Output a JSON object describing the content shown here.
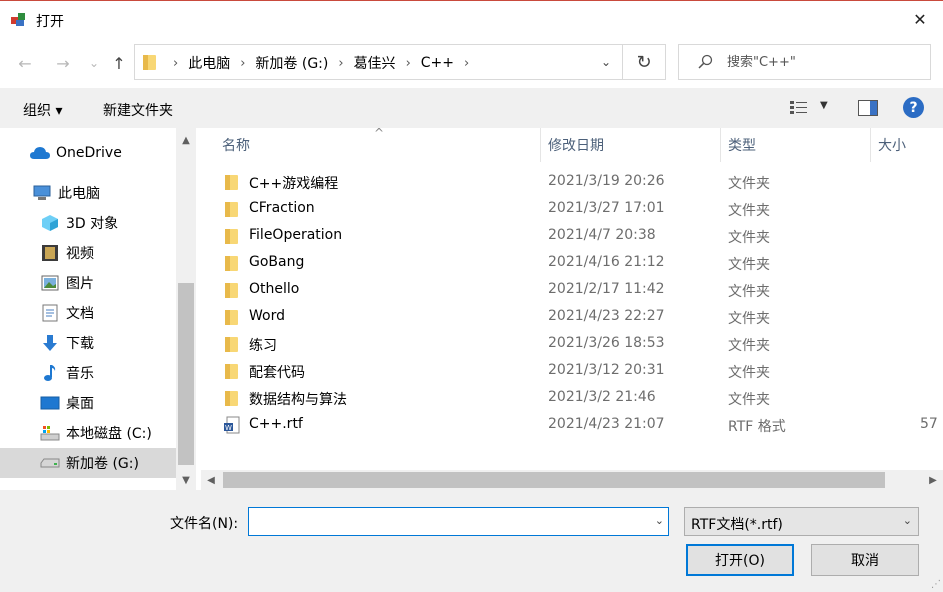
{
  "window": {
    "title": "打开",
    "close_glyph": "✕"
  },
  "nav": {
    "back_glyph": "←",
    "forward_glyph": "→",
    "recent_glyph": "⌄",
    "up_glyph": "↑",
    "breadcrumbs": [
      "此电脑",
      "新加卷 (G:)",
      "葛佳兴",
      "C++"
    ],
    "sep_glyph": "›",
    "dropdown_glyph": "⌄",
    "refresh_glyph": "↻"
  },
  "search": {
    "placeholder": "搜索\"C++\""
  },
  "toolbar": {
    "organize": "组织 ▾",
    "new_folder": "新建文件夹",
    "help": "?"
  },
  "sidebar": {
    "items": [
      {
        "label": "OneDrive",
        "icon": "cloud-icon"
      },
      {
        "label": "此电脑",
        "icon": "computer-icon"
      },
      {
        "label": "3D 对象",
        "icon": "cube-icon"
      },
      {
        "label": "视频",
        "icon": "video-icon"
      },
      {
        "label": "图片",
        "icon": "picture-icon"
      },
      {
        "label": "文档",
        "icon": "document-icon"
      },
      {
        "label": "下载",
        "icon": "download-icon"
      },
      {
        "label": "音乐",
        "icon": "music-icon"
      },
      {
        "label": "桌面",
        "icon": "desktop-icon"
      },
      {
        "label": "本地磁盘 (C:)",
        "icon": "drive-c-icon"
      },
      {
        "label": "新加卷 (G:)",
        "icon": "drive-g-icon",
        "selected": true
      }
    ]
  },
  "columns": {
    "name": "名称",
    "modified": "修改日期",
    "type": "类型",
    "size": "大小"
  },
  "files": [
    {
      "name": "C++游戏编程",
      "modified": "2021/3/19 20:26",
      "type": "文件夹",
      "size": "",
      "kind": "folder"
    },
    {
      "name": "CFraction",
      "modified": "2021/3/27 17:01",
      "type": "文件夹",
      "size": "",
      "kind": "folder"
    },
    {
      "name": "FileOperation",
      "modified": "2021/4/7 20:38",
      "type": "文件夹",
      "size": "",
      "kind": "folder"
    },
    {
      "name": "GoBang",
      "modified": "2021/4/16 21:12",
      "type": "文件夹",
      "size": "",
      "kind": "folder"
    },
    {
      "name": "Othello",
      "modified": "2021/2/17 11:42",
      "type": "文件夹",
      "size": "",
      "kind": "folder"
    },
    {
      "name": "Word",
      "modified": "2021/4/23 22:27",
      "type": "文件夹",
      "size": "",
      "kind": "folder"
    },
    {
      "name": "练习",
      "modified": "2021/3/26 18:53",
      "type": "文件夹",
      "size": "",
      "kind": "folder"
    },
    {
      "name": "配套代码",
      "modified": "2021/3/12 20:31",
      "type": "文件夹",
      "size": "",
      "kind": "folder"
    },
    {
      "name": "数据结构与算法",
      "modified": "2021/3/2 21:46",
      "type": "文件夹",
      "size": "",
      "kind": "folder"
    },
    {
      "name": "C++.rtf",
      "modified": "2021/4/23 21:07",
      "type": "RTF 格式",
      "size": "57",
      "kind": "rtf"
    }
  ],
  "bottom": {
    "filename_label": "文件名(N):",
    "filename_value": "",
    "filter": "RTF文档(*.rtf)",
    "open_button": "打开(O)",
    "cancel_button": "取消"
  },
  "colors": {
    "accent": "#0078d7",
    "folder": "#f8d775",
    "help": "#2b6cc4"
  }
}
